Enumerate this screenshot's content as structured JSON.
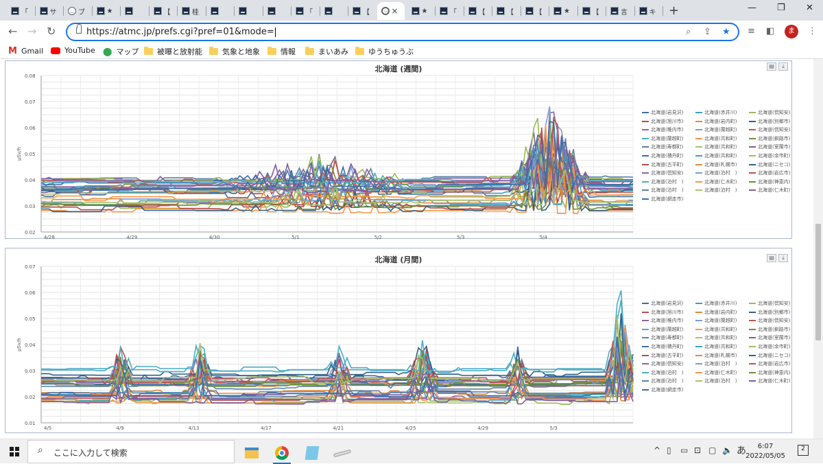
{
  "browser": {
    "tabs": [
      {
        "label": "「"
      },
      {
        "label": "サ"
      },
      {
        "label": "ブ"
      },
      {
        "label": "★"
      },
      {
        "label": ""
      },
      {
        "label": "【"
      },
      {
        "label": "桂"
      },
      {
        "label": ""
      },
      {
        "label": ""
      },
      {
        "label": ""
      },
      {
        "label": "「"
      },
      {
        "label": ""
      },
      {
        "label": "【"
      },
      {
        "label": "×",
        "active": true
      },
      {
        "label": "★"
      },
      {
        "label": "「"
      },
      {
        "label": "【"
      },
      {
        "label": "【"
      },
      {
        "label": "【"
      },
      {
        "label": "★"
      },
      {
        "label": "【"
      },
      {
        "label": "言"
      },
      {
        "label": "キ"
      }
    ],
    "new_tab": "+",
    "window_controls": [
      "—",
      "❐",
      "✕"
    ],
    "url": "https://atmc.jp/prefs.cgi?pref=01&mode=",
    "profile_initial": "ま",
    "bookmarks": [
      {
        "label": "Gmail",
        "icon": "gmail-icon"
      },
      {
        "label": "YouTube",
        "icon": "youtube-icon"
      },
      {
        "label": "マップ",
        "icon": "maps-icon"
      },
      {
        "label": "被曝と放射能",
        "icon": "folder-icon"
      },
      {
        "label": "気象と地象",
        "icon": "folder-icon"
      },
      {
        "label": "情報",
        "icon": "folder-icon"
      },
      {
        "label": "まいあみ",
        "icon": "folder-icon"
      },
      {
        "label": "ゆうちゅうぶ",
        "icon": "folder-icon"
      }
    ]
  },
  "legend_entries": [
    "北海道(岩見沢)",
    "北海道(赤井川)",
    "北海道(倶知安)",
    "北海道(旭川市)",
    "北海道(岩内町)",
    "北海道(別郷市)",
    "北海道(稚内市)",
    "北海道(蘭越町)",
    "北海道(倶知安)",
    "北海道(蘭越町)",
    "北海道(共和町)",
    "北海道(釧路市)",
    "北海道(寿都町)",
    "北海道(共和町)",
    "北海道(室蘭市)",
    "北海道(積丹町)",
    "北海道(共和町)",
    "北海道(余市町)",
    "北海道(古平町)",
    "北海道(札幌市)",
    "北海道(ニセコ)",
    "北海道(倶知安)",
    "北海道(泊村　)",
    "北海道(岩広市)",
    "北海道(泊村　)",
    "北海道(仁木町)",
    "北海道(神恵内)",
    "北海道(泊村　)",
    "北海道(泊村　)",
    "北海道(仁木町)",
    "北海道(網走市)"
  ],
  "chart_data": [
    {
      "type": "line",
      "title": "北海道 (週間)",
      "ylabel": "μSv/h",
      "ylim": [
        0.02,
        0.08
      ],
      "yticks": [
        "0.08",
        "0.07",
        "0.06",
        "0.05",
        "0.04",
        "0.03",
        "0.02"
      ],
      "xticks": [
        "4/28",
        "4/29",
        "4/30",
        "5/1",
        "5/2",
        "5/3",
        "5/4"
      ],
      "series_colors": [
        "#3c6ea8",
        "#3aa0c0",
        "#9bbb59",
        "#b84b4b",
        "#e08a3c",
        "#2e5f8a",
        "#8a63a8",
        "#7a9cd0",
        "#c0504d",
        "#4bacc6",
        "#f79646",
        "#6a8f3a",
        "#5b7fa8",
        "#aabf6e",
        "#7d5c9e"
      ]
    },
    {
      "type": "line",
      "title": "北海道 (月間)",
      "ylabel": "μSv/h",
      "ylim": [
        0.01,
        0.07
      ],
      "yticks": [
        "0.07",
        "0.06",
        "0.05",
        "0.04",
        "0.03",
        "0.02",
        "0.01"
      ],
      "xticks": [
        "4/5",
        "4/9",
        "4/13",
        "4/17",
        "4/21",
        "4/25",
        "4/29",
        "5/3"
      ],
      "series_colors": [
        "#3c6ea8",
        "#3aa0c0",
        "#9bbb59",
        "#b84b4b",
        "#e08a3c",
        "#2e5f8a",
        "#8a63a8",
        "#7a9cd0",
        "#c0504d",
        "#4bacc6",
        "#f79646",
        "#6a8f3a",
        "#5b7fa8",
        "#aabf6e",
        "#7d5c9e"
      ]
    }
  ],
  "taskbar": {
    "search_placeholder": "ここに入力して検索",
    "ime": "あ",
    "time": "6:07",
    "date": "2022/05/05",
    "notifications": "2"
  }
}
